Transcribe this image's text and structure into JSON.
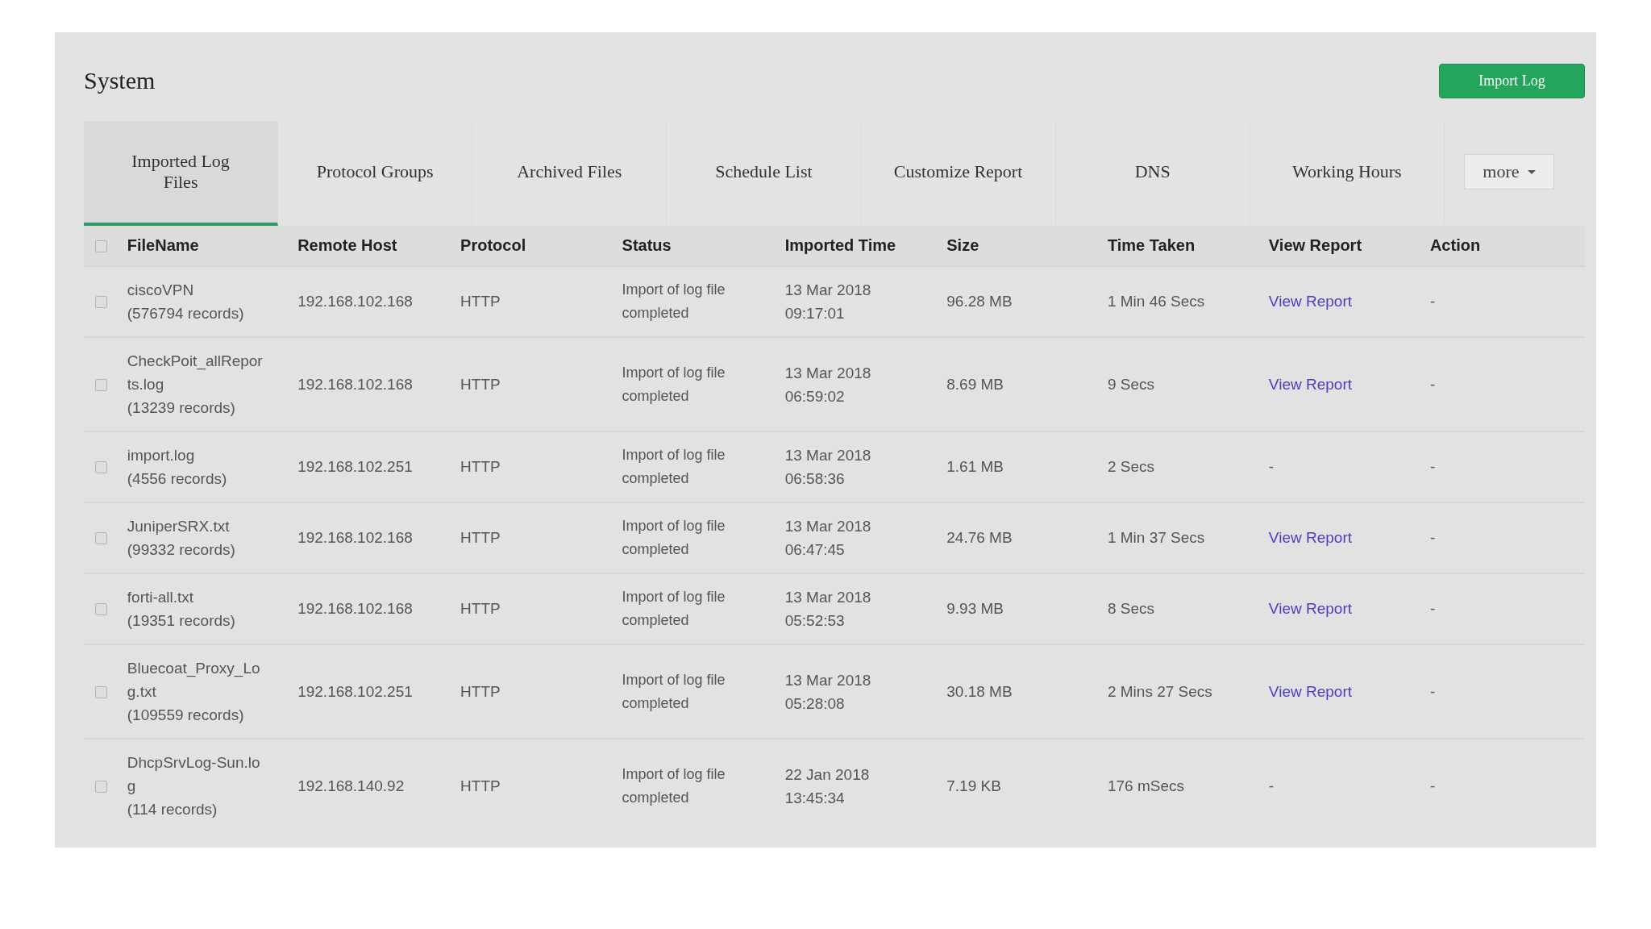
{
  "page": {
    "title": "System",
    "import_button": "Import Log"
  },
  "tabs": [
    {
      "label": "Imported Log Files",
      "selected": true
    },
    {
      "label": "Protocol Groups",
      "selected": false
    },
    {
      "label": "Archived Files",
      "selected": false
    },
    {
      "label": "Schedule List",
      "selected": false
    },
    {
      "label": "Customize Report",
      "selected": false
    },
    {
      "label": "DNS",
      "selected": false
    },
    {
      "label": "Working Hours",
      "selected": false
    }
  ],
  "more_button": "more",
  "table": {
    "select_all_checked": false,
    "columns": [
      "FileName",
      "Remote Host",
      "Protocol",
      "Status",
      "Imported Time",
      "Size",
      "Time Taken",
      "View Report",
      "Action"
    ],
    "rows": [
      {
        "checked": false,
        "file": "ciscoVPN",
        "records": "(576794 records)",
        "host": "192.168.102.168",
        "protocol": "HTTP",
        "status": "Import of log file completed",
        "date": "13 Mar 2018",
        "time": "09:17:01",
        "size": "96.28 MB",
        "taken": "1 Min 46 Secs",
        "report": {
          "kind": "link",
          "text": "View Report"
        },
        "action": "-"
      },
      {
        "checked": false,
        "file": "CheckPoit_allReports.log",
        "records": "(13239 records)",
        "host": "192.168.102.168",
        "protocol": "HTTP",
        "status": "Import of log file completed",
        "date": "13 Mar 2018",
        "time": "06:59:02",
        "size": "8.69 MB",
        "taken": "9 Secs",
        "report": {
          "kind": "link",
          "text": "View Report"
        },
        "action": "-"
      },
      {
        "checked": false,
        "file": "import.log",
        "records": "(4556 records)",
        "host": "192.168.102.251",
        "protocol": "HTTP",
        "status": "Import of log file completed",
        "date": "13 Mar 2018",
        "time": "06:58:36",
        "size": "1.61 MB",
        "taken": "2 Secs",
        "report": {
          "kind": "text",
          "text": "-"
        },
        "action": "-"
      },
      {
        "checked": false,
        "file": "JuniperSRX.txt",
        "records": "(99332 records)",
        "host": "192.168.102.168",
        "protocol": "HTTP",
        "status": "Import of log file completed",
        "date": "13 Mar 2018",
        "time": "06:47:45",
        "size": "24.76 MB",
        "taken": "1 Min 37 Secs",
        "report": {
          "kind": "link",
          "text": "View Report"
        },
        "action": "-"
      },
      {
        "checked": false,
        "file": "forti-all.txt",
        "records": "(19351 records)",
        "host": "192.168.102.168",
        "protocol": "HTTP",
        "status": "Import of log file completed",
        "date": "13 Mar 2018",
        "time": "05:52:53",
        "size": "9.93 MB",
        "taken": "8 Secs",
        "report": {
          "kind": "link",
          "text": "View Report"
        },
        "action": "-"
      },
      {
        "checked": false,
        "file": "Bluecoat_Proxy_Log.txt",
        "records": "(109559 records)",
        "host": "192.168.102.251",
        "protocol": "HTTP",
        "status": "Import of log file completed",
        "date": "13 Mar 2018",
        "time": "05:28:08",
        "size": "30.18 MB",
        "taken": "2 Mins 27 Secs",
        "report": {
          "kind": "link",
          "text": "View Report"
        },
        "action": "-"
      },
      {
        "checked": false,
        "file": "DhcpSrvLog-Sun.log",
        "records": "(114 records)",
        "host": "192.168.140.92",
        "protocol": "HTTP",
        "status": "Import of log file completed",
        "date": "22 Jan 2018",
        "time": "13:45:34",
        "size": "7.19 KB",
        "taken": "176 mSecs",
        "report": {
          "kind": "text",
          "text": "-"
        },
        "action": "-"
      }
    ]
  }
}
